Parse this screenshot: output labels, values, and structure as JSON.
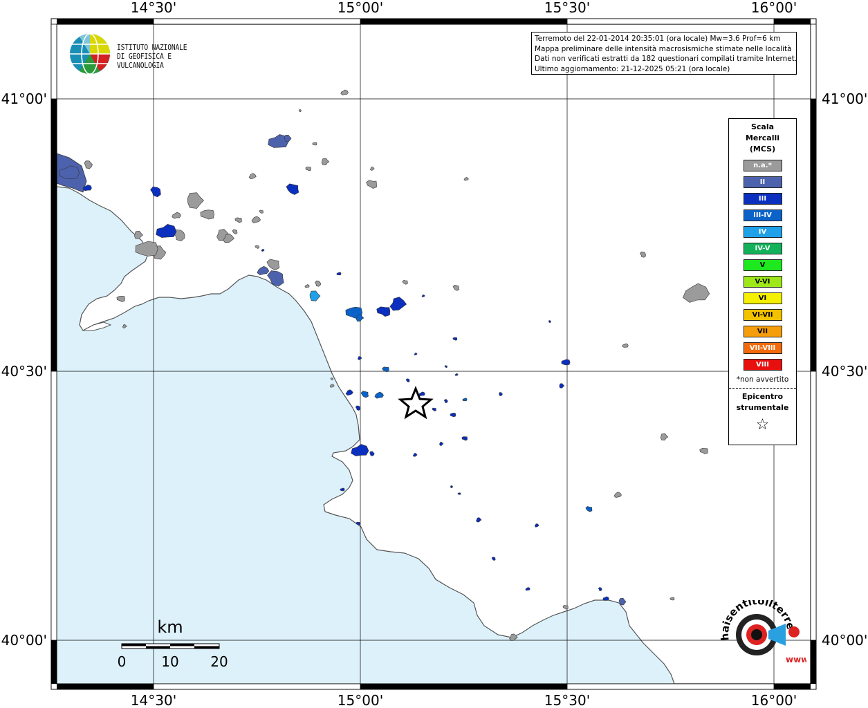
{
  "map": {
    "lon_ticks": [
      "14°30'",
      "15°00'",
      "15°30'",
      "16°00'"
    ],
    "lat_ticks": [
      "41°00'",
      "40°30'",
      "40°00'"
    ],
    "scale": {
      "unit": "km",
      "labels": [
        "0",
        "10",
        "20"
      ]
    },
    "colors": {
      "sea": "#ddf1fb",
      "land": "#ffffff",
      "grid": "#000000",
      "na": "#9b9b9b"
    }
  },
  "info": {
    "line1": "Terremoto del 22-01-2014 20:35:01 (ora locale) Mw=3.6 Prof=6 km",
    "line2": "Mappa preliminare delle intensità macrosismiche stimate nelle località",
    "line3": "Dati non verificati estratti da 182 questionari compilati tramite Internet.",
    "line4": "Ultimo aggiornamento: 21-12-2025 05:21 (ora locale)"
  },
  "logo": {
    "line1": "ISTITUTO NAZIONALE",
    "line2": "DI GEOFISICA E VULCANOLOGIA"
  },
  "legend": {
    "title_line1": "Scala",
    "title_line2": "Mercalli",
    "title_line3": "(MCS)",
    "items": [
      {
        "label": "n.a.*",
        "color": "#9b9b9b"
      },
      {
        "label": "II",
        "color": "#4d62ad"
      },
      {
        "label": "III",
        "color": "#0b2fbf"
      },
      {
        "label": "III-IV",
        "color": "#0b63c9"
      },
      {
        "label": "IV",
        "color": "#1ea1e8"
      },
      {
        "label": "IV-V",
        "color": "#12b15a"
      },
      {
        "label": "V",
        "color": "#1ee81e"
      },
      {
        "label": "V-VI",
        "color": "#9ee81a"
      },
      {
        "label": "VI",
        "color": "#f4f000"
      },
      {
        "label": "VI-VII",
        "color": "#f2c200"
      },
      {
        "label": "VII",
        "color": "#f59d0b"
      },
      {
        "label": "VII-VIII",
        "color": "#f26a0b"
      },
      {
        "label": "VIII",
        "color": "#e8100f"
      }
    ],
    "note": "*non avvertito",
    "epicentro_line1": "Epicentro",
    "epicentro_line2": "strumentale",
    "star": "☆"
  },
  "haisentito": {
    "text": "haisentitoilterremoto.it",
    "url_text": "www."
  }
}
